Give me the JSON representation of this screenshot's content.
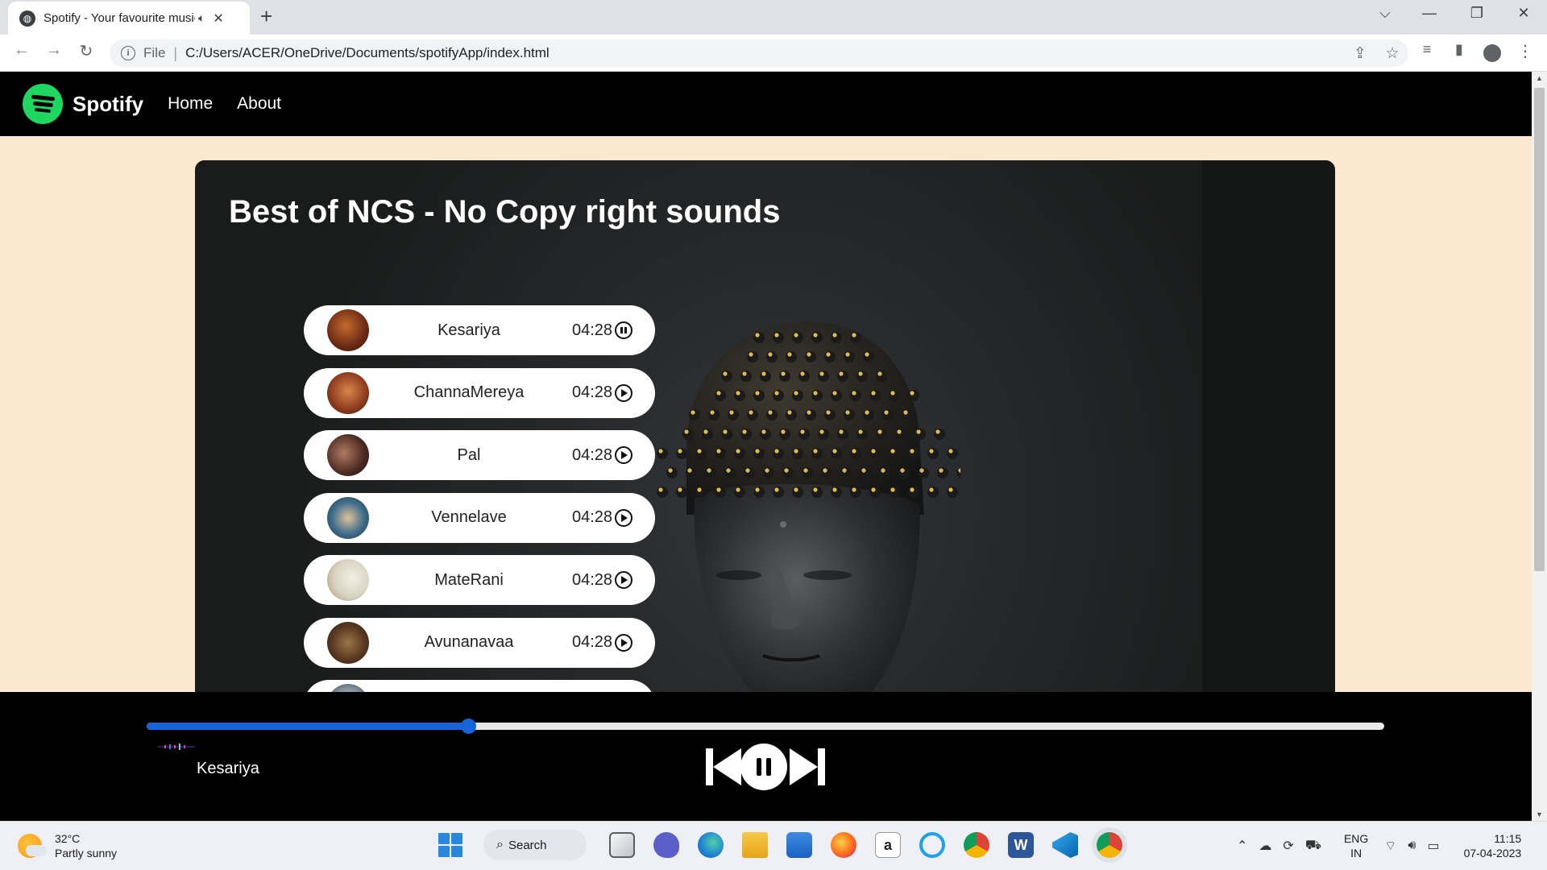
{
  "browser": {
    "tab_title": "Spotify - Your favourite music",
    "address_scheme": "File",
    "address_url": "C:/Users/ACER/OneDrive/Documents/spotifyApp/index.html"
  },
  "nav": {
    "brand": "Spotify",
    "links": [
      "Home",
      "About"
    ]
  },
  "page": {
    "heading": "Best of NCS - No Copy right sounds"
  },
  "songs": [
    {
      "name": "Kesariya",
      "duration": "04:28",
      "state": "pause"
    },
    {
      "name": "ChannaMereya",
      "duration": "04:28",
      "state": "play"
    },
    {
      "name": "Pal",
      "duration": "04:28",
      "state": "play"
    },
    {
      "name": "Vennelave",
      "duration": "04:28",
      "state": "play"
    },
    {
      "name": "MateRani",
      "duration": "04:28",
      "state": "play"
    },
    {
      "name": "Avunanavaa",
      "duration": "04:28",
      "state": "play"
    }
  ],
  "player": {
    "current_song": "Kesariya",
    "progress": 0.26,
    "accent_color": "#1565d8"
  },
  "taskbar": {
    "temperature": "32°C",
    "weather": "Partly sunny",
    "search_label": "Search",
    "lang_line1": "ENG",
    "lang_line2": "IN",
    "time": "11:15",
    "date": "07-04-2023"
  },
  "colors": {
    "brand_green": "#1ed760",
    "page_bg": "#fce8cf"
  }
}
